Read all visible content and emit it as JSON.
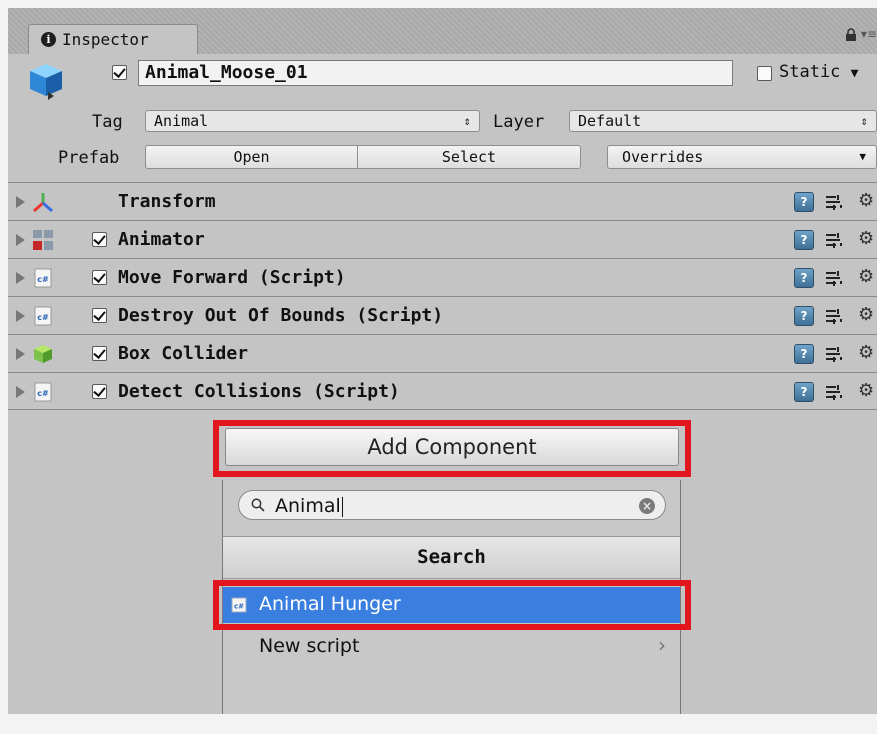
{
  "tab": {
    "icon": "info-icon",
    "label": "Inspector",
    "lock_icon": "lock-icon",
    "menu_icon": "tab-menu-icon"
  },
  "object": {
    "icon": "gameobject-cube-icon",
    "active": true,
    "name": "Animal_Moose_01",
    "static_label": "Static",
    "static_checked": false,
    "tag_label": "Tag",
    "tag_value": "Animal",
    "layer_label": "Layer",
    "layer_value": "Default",
    "prefab_label": "Prefab",
    "prefab_open": "Open",
    "prefab_select": "Select",
    "prefab_overrides": "Overrides"
  },
  "components": [
    {
      "label": "Transform",
      "icon": "transform-axes-icon",
      "has_checkbox": false
    },
    {
      "label": "Animator",
      "icon": "animator-icon",
      "has_checkbox": true
    },
    {
      "label": "Move Forward (Script)",
      "icon": "csharp-script-icon",
      "has_checkbox": true
    },
    {
      "label": "Destroy Out Of Bounds (Script)",
      "icon": "csharp-script-icon",
      "has_checkbox": true
    },
    {
      "label": "Box Collider",
      "icon": "box-collider-icon",
      "has_checkbox": true
    },
    {
      "label": "Detect Collisions (Script)",
      "icon": "csharp-script-icon",
      "has_checkbox": true
    }
  ],
  "add_component": {
    "button_label": "Add Component",
    "search_value": "Animal",
    "search_header": "Search",
    "result_label": "Animal Hunger",
    "new_script_label": "New script"
  },
  "colors": {
    "highlight": "#e3161d",
    "selection": "#3a7fe0"
  }
}
